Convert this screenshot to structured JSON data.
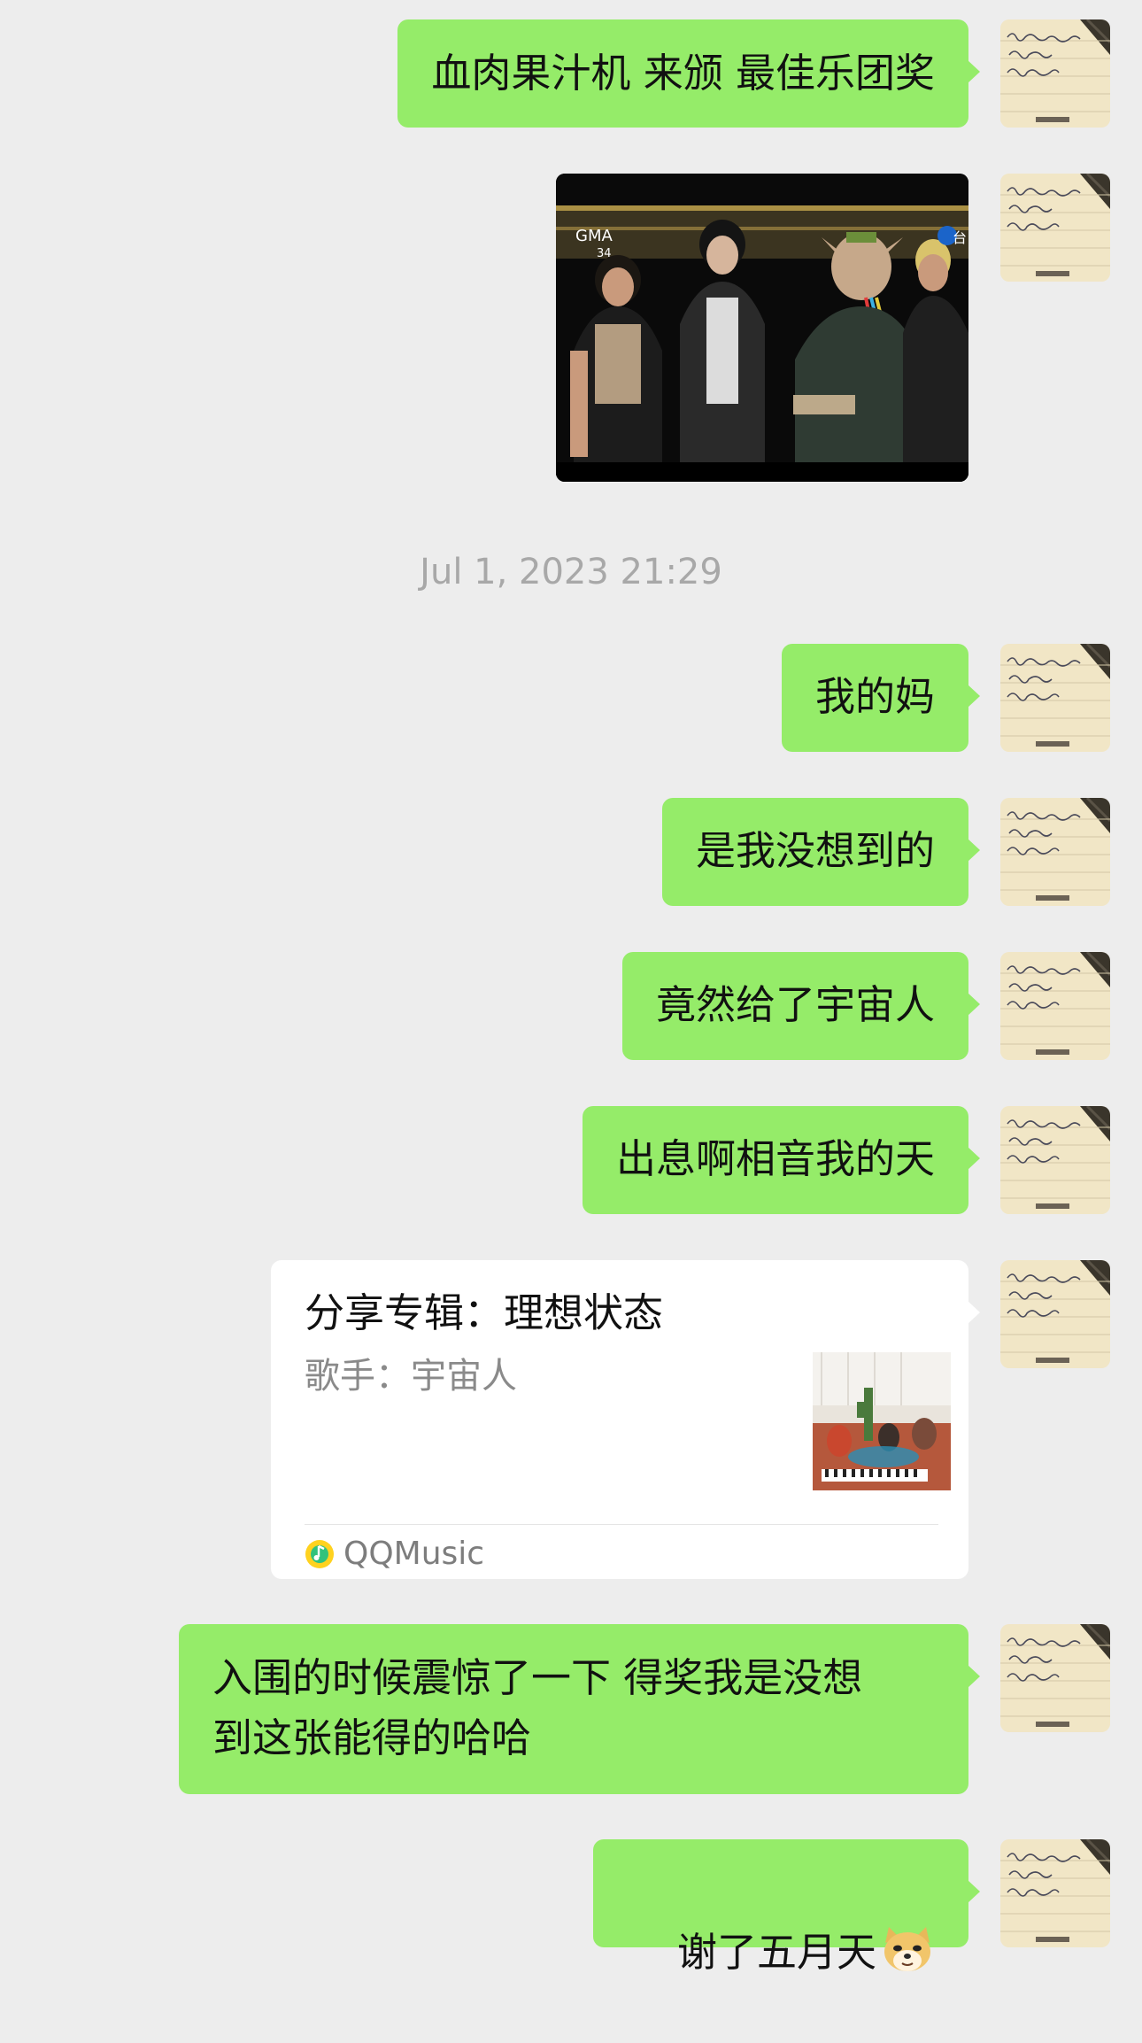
{
  "messages": {
    "m1": "血肉果汁机 来颁 最佳乐团奖",
    "m2": "我的妈",
    "m3": "是我没想到的",
    "m4": "竟然给了宇宙人",
    "m5": "出息啊相音我的天",
    "m6": "入围的时候震惊了一下 得奖我是没想\n到这张能得的哈哈",
    "m7": "谢了五月天"
  },
  "timestamp": "Jul 1, 2023 21:29",
  "photo": {
    "logo": "GMA",
    "logo_num": "34",
    "channel": "台"
  },
  "music_card": {
    "title": "分享专辑：理想状态",
    "artist": "歌手：宇宙人",
    "source": "QQMusic"
  },
  "icons": {
    "avatar": "handwriting-notebook-avatar",
    "emoji": "doge-emoji",
    "source": "qqmusic-icon"
  },
  "colors": {
    "background": "#ededed",
    "bubble": "#95ec69",
    "card": "#ffffff",
    "timestamp": "#a8a8a8"
  }
}
